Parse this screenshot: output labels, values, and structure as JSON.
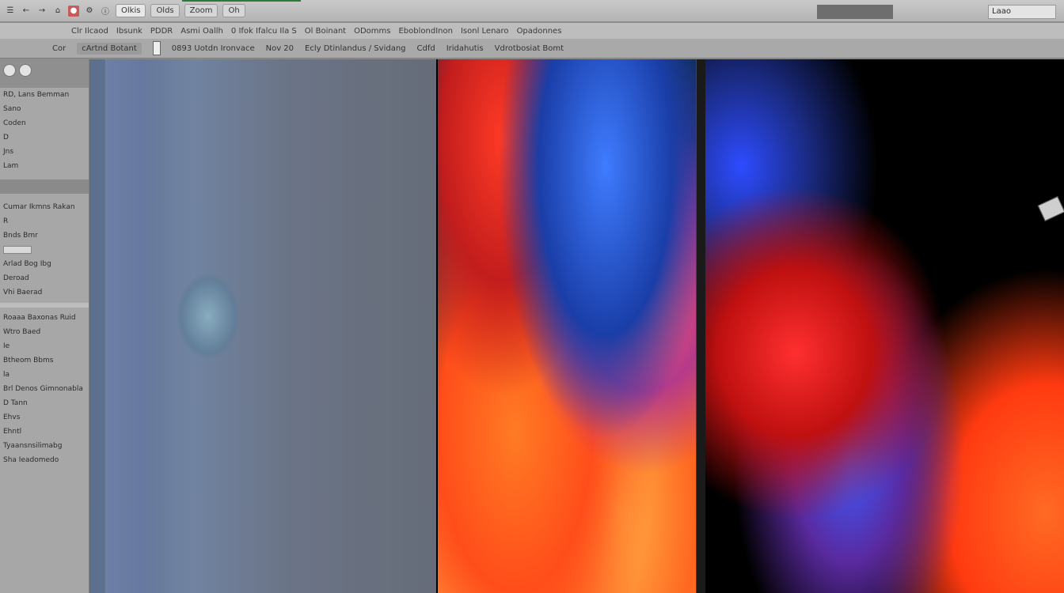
{
  "topbar": {
    "tabs": [
      "Olkis",
      "Olds",
      "Zoom",
      "Oh"
    ],
    "zoom_label": "Laao"
  },
  "toolbar2": {
    "items": [
      "Clr Ilcaod",
      "Ibsunk",
      "PDDR",
      "Asmi Oallh",
      "0 Ifok Ifalcu Ila S",
      "Ol Boinant",
      "ODomms",
      "EboblondInon",
      "Isonl Lenaro",
      "Opadonnes"
    ]
  },
  "toolbar3": {
    "label_left": "Cor",
    "field1": "cArtnd Botant",
    "field2": "0893 Uotdn Ironvace",
    "field3": "Nov 20",
    "field4": "Ecly Dtinlandus / Svidang",
    "field5": "Cdfd",
    "field6": "Iridahutis",
    "field7": "Vdrotbosiat Bomt"
  },
  "left_panel": {
    "rows_top": [
      "RD, Lans Bemman",
      "",
      "Sano",
      "",
      "Coden",
      "",
      "D",
      "Jns",
      "",
      "Lam"
    ],
    "section2_title": "Cumar Ikmns Rakan",
    "rows_mid": [
      "R",
      "Bnds Bmr",
      "",
      "Arlad Bog Ibg",
      "Deroad",
      "Vhi Baerad"
    ],
    "rows_low": [
      "Roaaa Baxonas Ruid",
      "Wtro Baed",
      "Ie",
      "Btheom Bbms",
      "la",
      "Brl Denos Gimnonabla",
      "D Tann",
      "Ehvs",
      "Ehntl",
      "Tyaansnsilimabg",
      "Sha Ieadomedo"
    ]
  }
}
